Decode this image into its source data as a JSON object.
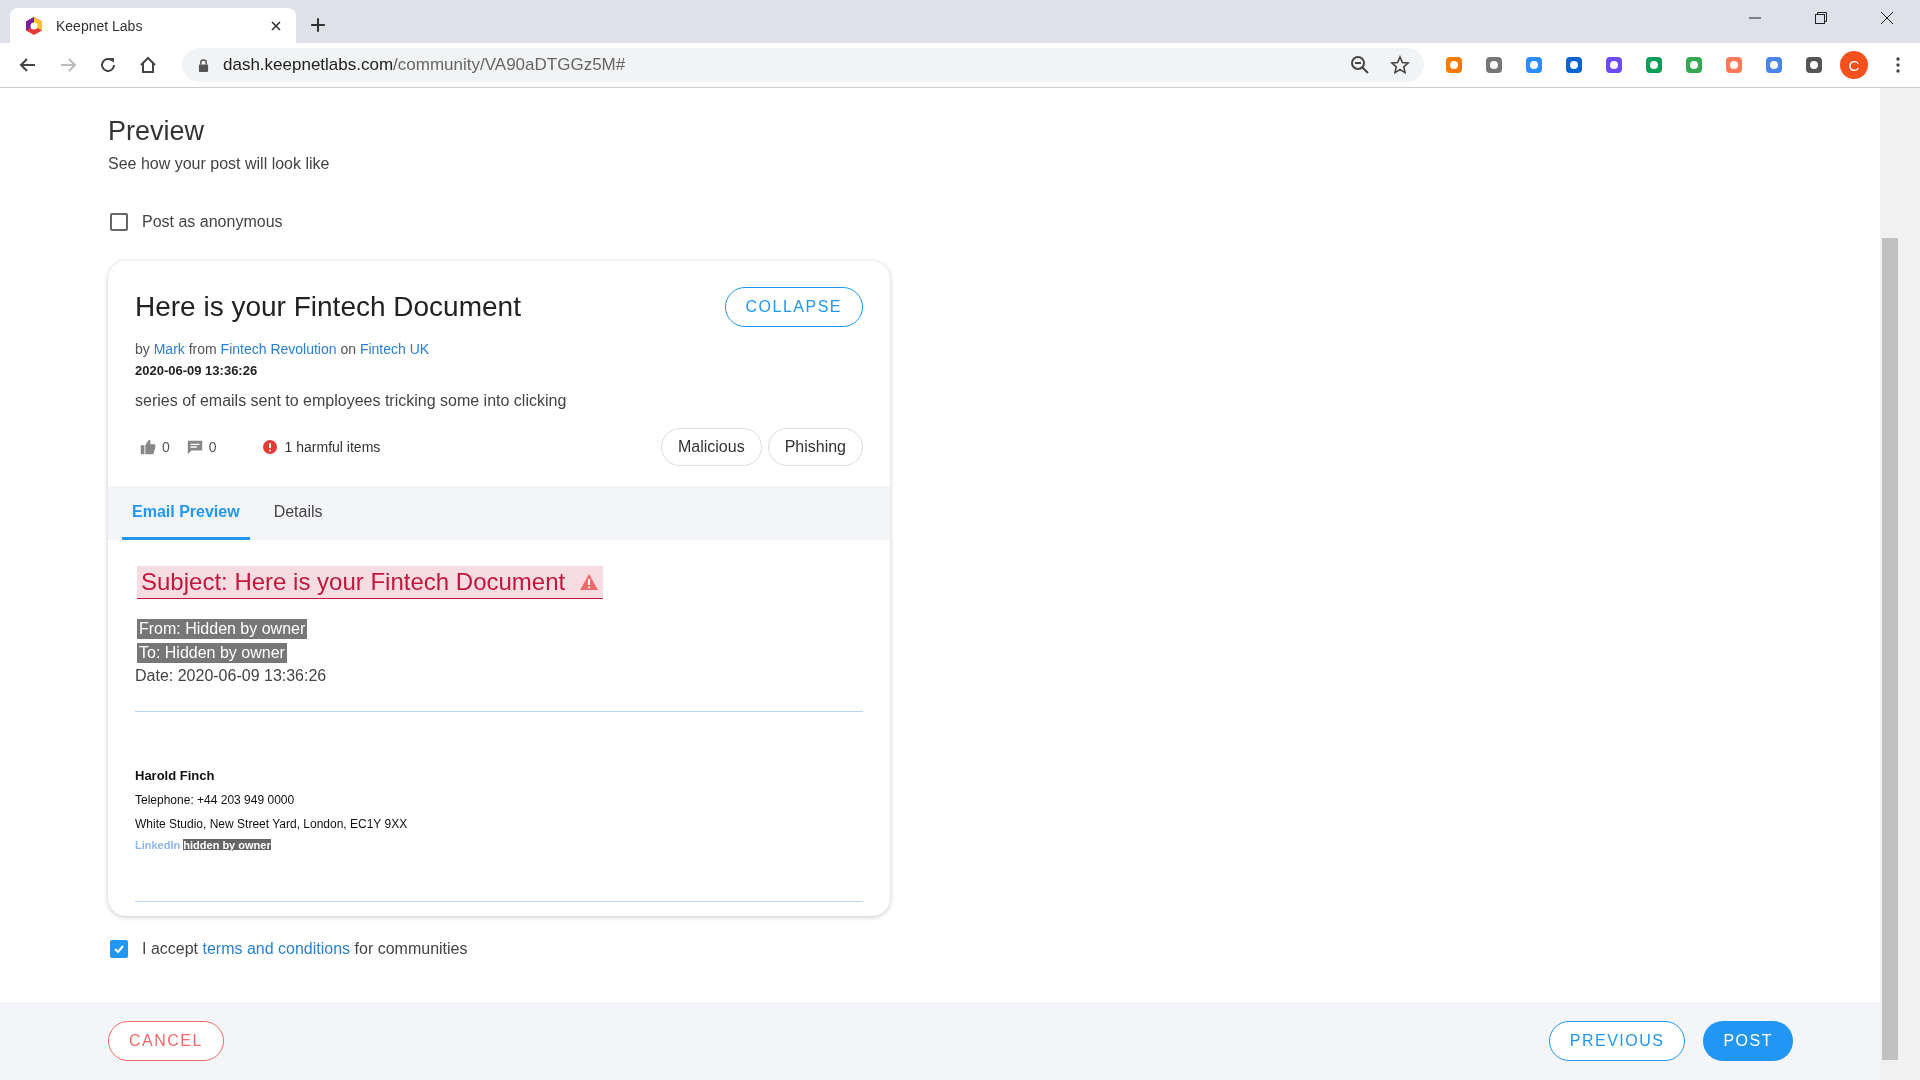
{
  "browser": {
    "tab_title": "Keepnet Labs",
    "url_host": "dash.keepnetlabs.com",
    "url_path": "/community/VA90aDTGGz5M#",
    "profile_initial": "C"
  },
  "page": {
    "title": "Preview",
    "subtitle": "See how your post will look like",
    "anonymous": {
      "label": "Post as anonymous",
      "checked": false
    }
  },
  "post": {
    "title": "Here is your Fintech Document",
    "collapse_button": "COLLAPSE",
    "byline": {
      "by": "by",
      "author": "Mark",
      "from": "from",
      "group": "Fintech Revolution",
      "on": "on",
      "community": "Fintech UK"
    },
    "date": "2020-06-09 13:36:26",
    "description": "series of emails sent to employees tricking some into clicking",
    "likes": "0",
    "comments": "0",
    "harmful": "1 harmful items",
    "tags": [
      "Malicious",
      "Phishing"
    ],
    "tabs": [
      {
        "label": "Email Preview",
        "selected": true
      },
      {
        "label": "Details",
        "selected": false
      }
    ],
    "email": {
      "subject": "Subject: Here is your Fintech Document",
      "from": "From: Hidden by owner",
      "to": "To: Hidden by owner",
      "date": "Date: 2020-06-09 13:36:26",
      "signature": {
        "name": "Harold Finch",
        "telephone": "Telephone: +44 203 949 0000",
        "address": "White Studio, New Street Yard, London, EC1Y 9XX",
        "link_label": "LinkedIn",
        "link_hidden": "hidden by owner"
      }
    }
  },
  "terms": {
    "checked": true,
    "before": "I accept",
    "link": "terms and conditions",
    "after": "for communities"
  },
  "footer": {
    "cancel": "CANCEL",
    "previous": "PREVIOUS",
    "post": "POST"
  }
}
